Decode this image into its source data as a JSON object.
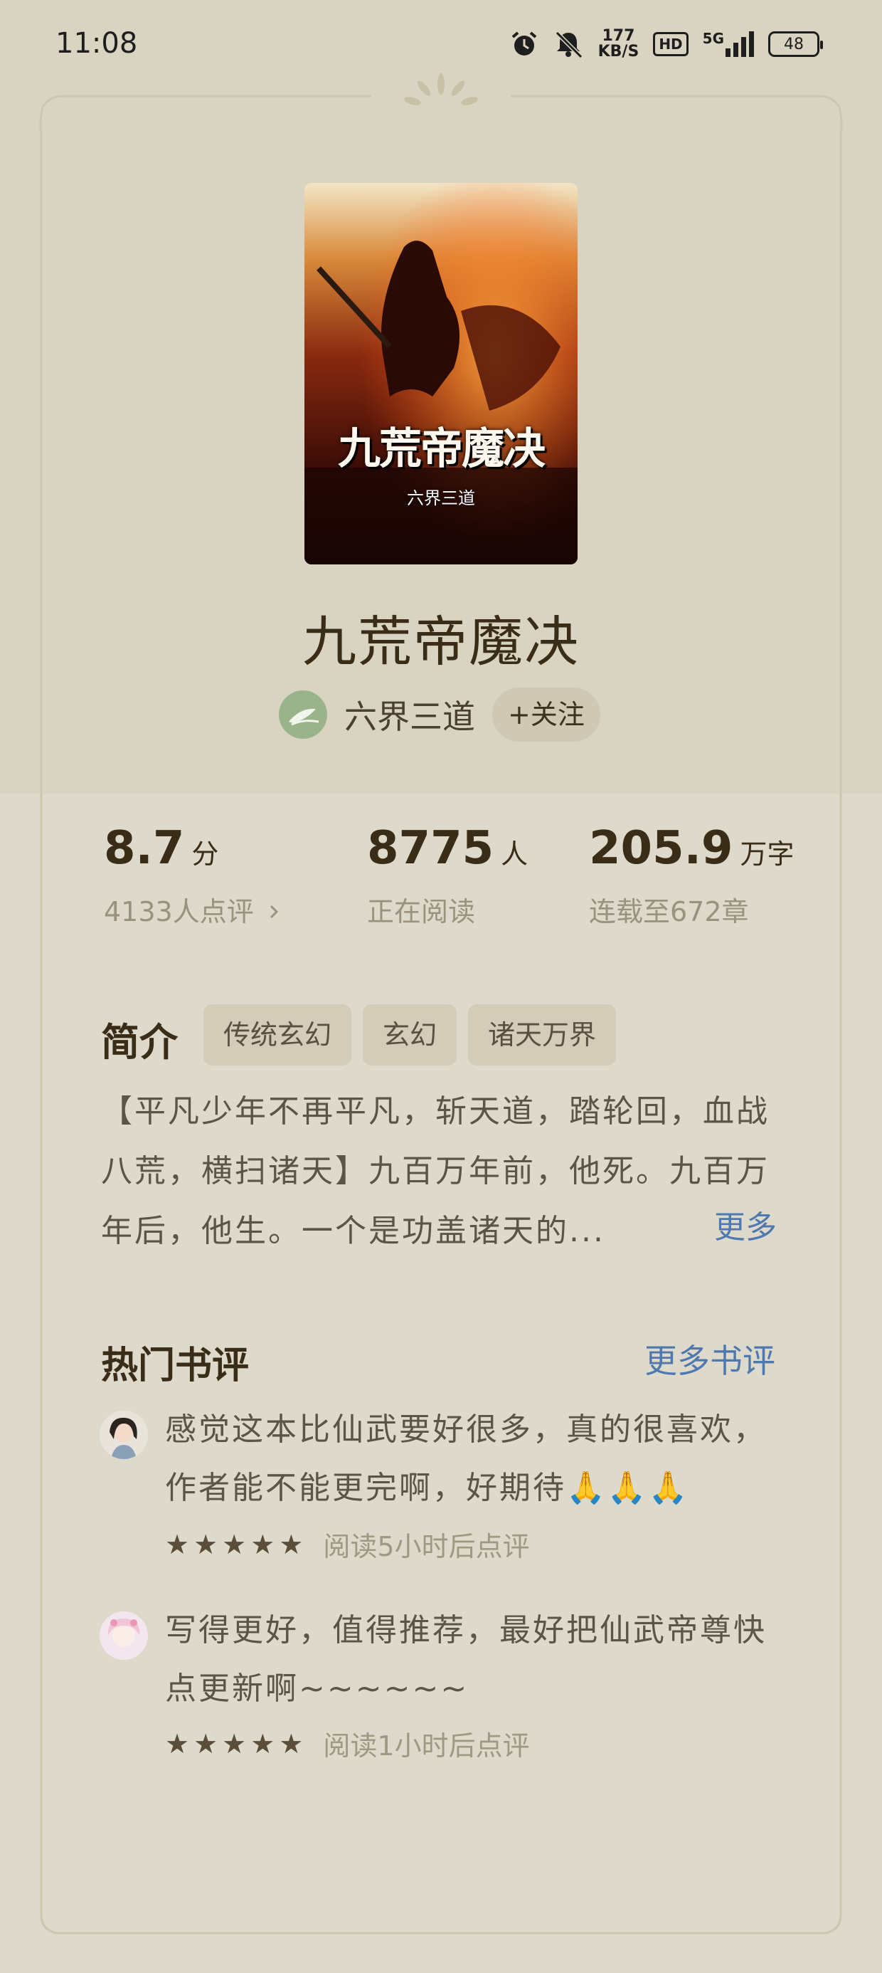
{
  "status_bar": {
    "time": "11:08",
    "speed_value": "177",
    "speed_unit": "KB/S",
    "hd": "HD",
    "network": "5G",
    "battery": "48"
  },
  "book": {
    "cover_title": "九荒帝魔决",
    "cover_author": "六界三道",
    "title": "九荒帝魔决",
    "author": "六界三道",
    "follow_label": "+关注"
  },
  "stats": {
    "score": {
      "value": "8.7",
      "unit": "分",
      "sub": "4133人点评"
    },
    "readers": {
      "value": "8775",
      "unit": "人",
      "sub": "正在阅读"
    },
    "words": {
      "value": "205.9",
      "unit": "万字",
      "sub": "连载至672章"
    }
  },
  "intro": {
    "label": "简介",
    "tags": [
      "传统玄幻",
      "玄幻",
      "诸天万界"
    ],
    "text": "【平凡少年不再平凡，斩天道，踏轮回，血战八荒，横扫诸天】九百万年前，他死。九百万年后，他生。一个是功盖诸天的...",
    "more_label": "更多"
  },
  "reviews": {
    "title": "热门书评",
    "more_label": "更多书评",
    "items": [
      {
        "text": "感觉这本比仙武要好很多，真的很喜欢，作者能不能更完啊，好期待🙏🙏🙏",
        "rating": 5,
        "time": "阅读5小时后点评"
      },
      {
        "text": "写得更好，值得推荐，最好把仙武帝尊快点更新啊~~~~~~",
        "rating": 5,
        "time": "阅读1小时后点评"
      }
    ]
  },
  "colors": {
    "background": "#dedacb",
    "top_band": "#d9d4c2",
    "link": "#4f78b0",
    "title": "#3a2d18"
  }
}
